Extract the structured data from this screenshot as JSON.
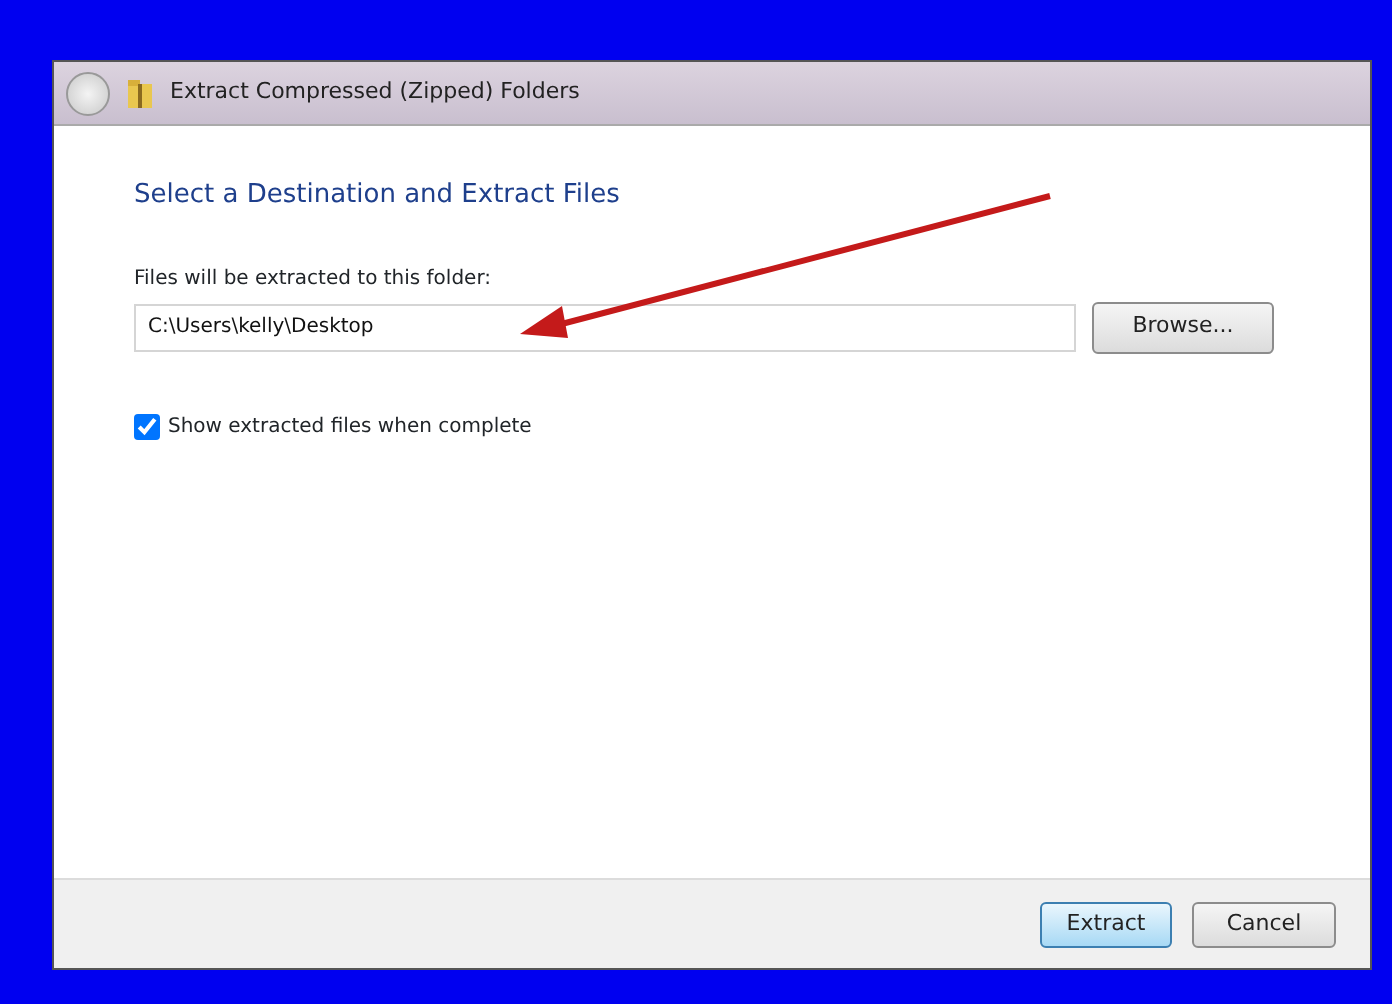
{
  "window": {
    "title": "Extract Compressed (Zipped) Folders"
  },
  "heading": "Select a Destination and Extract Files",
  "destination": {
    "label": "Files will be extracted to this folder:",
    "value": "C:\\Users\\kelly\\Desktop"
  },
  "browse_button": "Browse...",
  "show_files": {
    "label": "Show extracted files when complete",
    "checked": true
  },
  "buttons": [
    {
      "label": "Extract",
      "default": true
    },
    {
      "label": "Cancel",
      "default": false
    }
  ]
}
